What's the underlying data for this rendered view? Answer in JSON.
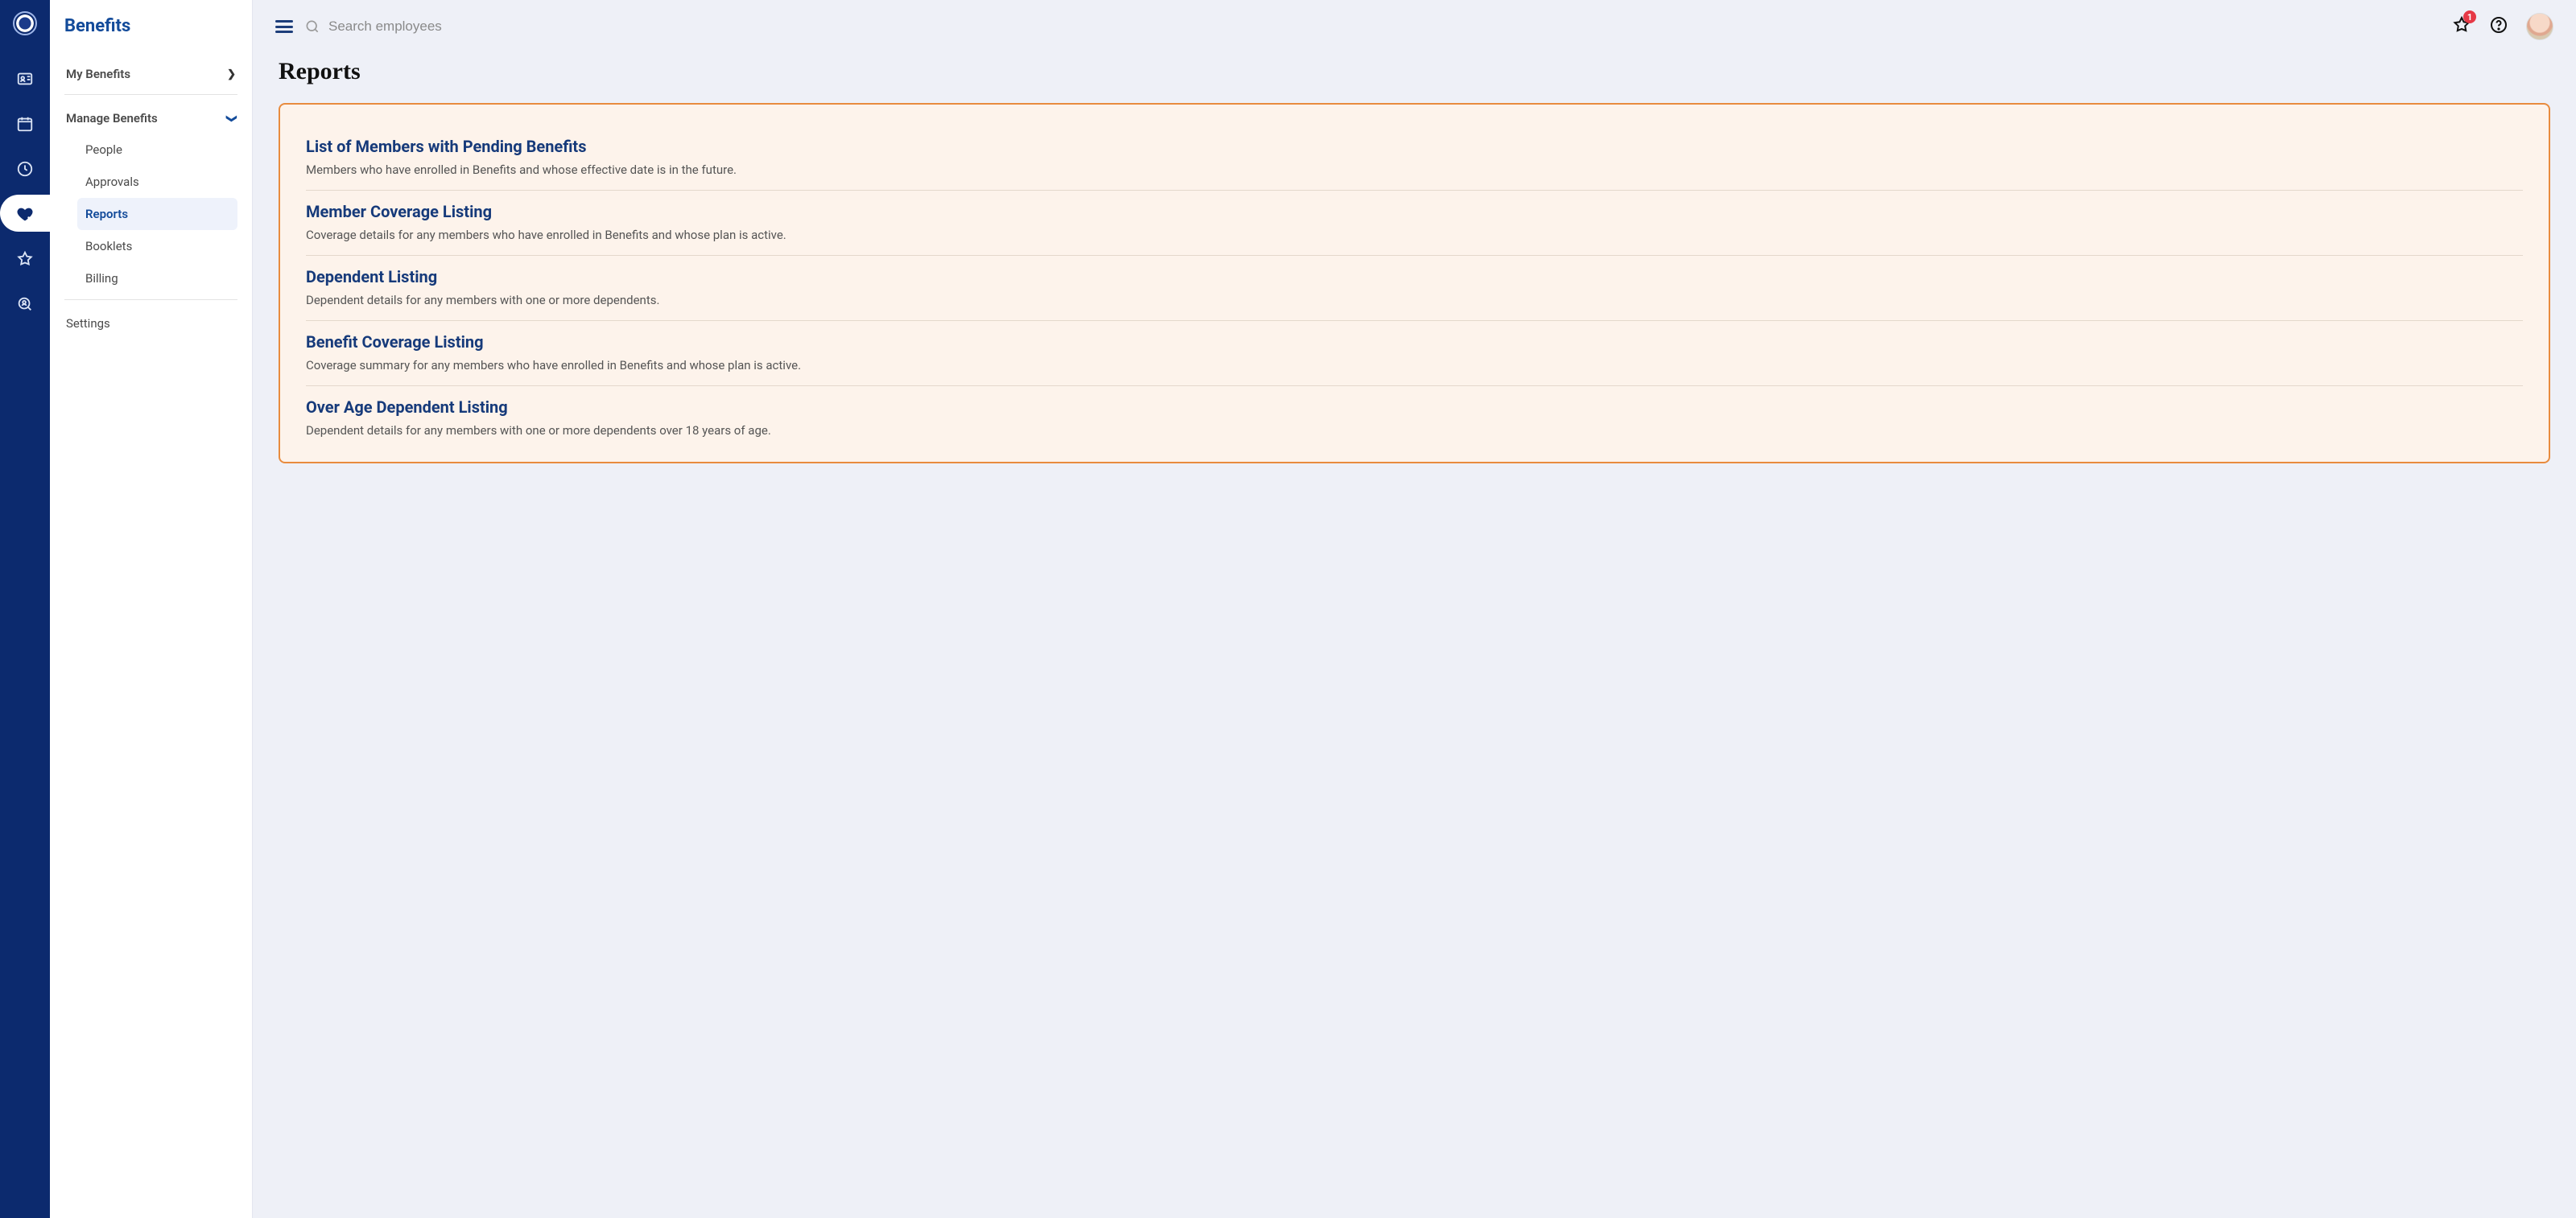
{
  "sidebar": {
    "title": "Benefits",
    "item_my_benefits": "My Benefits",
    "item_manage_benefits": "Manage Benefits",
    "sub_people": "People",
    "sub_approvals": "Approvals",
    "sub_reports": "Reports",
    "sub_booklets": "Booklets",
    "sub_billing": "Billing",
    "item_settings": "Settings"
  },
  "topbar": {
    "search_placeholder": "Search employees",
    "badge_count": "1"
  },
  "page": {
    "title": "Reports"
  },
  "reports": [
    {
      "title": "List of Members with Pending Benefits",
      "desc": "Members who have enrolled in Benefits and whose effective date is in the future."
    },
    {
      "title": "Member Coverage Listing",
      "desc": "Coverage details for any members who have enrolled in Benefits and whose plan is active."
    },
    {
      "title": "Dependent Listing",
      "desc": "Dependent details for any members with one or more dependents."
    },
    {
      "title": "Benefit Coverage Listing",
      "desc": "Coverage summary for any members who have enrolled in Benefits and whose plan is active."
    },
    {
      "title": "Over Age Dependent Listing",
      "desc": "Dependent details for any members with one or more dependents over 18 years of age."
    }
  ]
}
